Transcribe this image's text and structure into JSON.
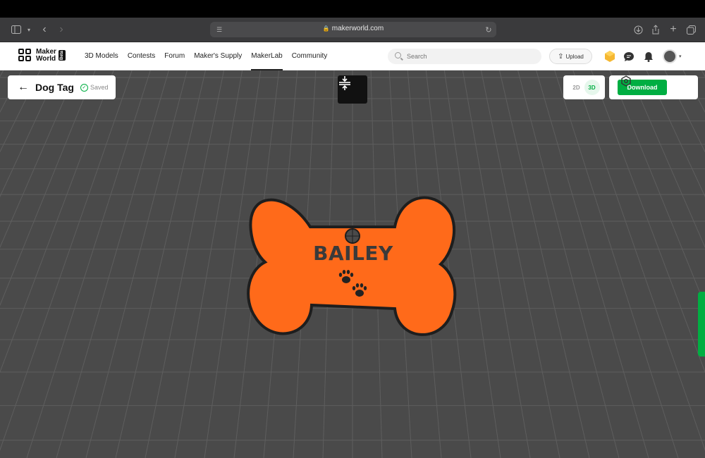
{
  "browser": {
    "url": "makerworld.com"
  },
  "site": {
    "logo_line1": "Maker",
    "logo_line2": "World",
    "logo_badge": "Beta",
    "nav": [
      "3D Models",
      "Contests",
      "Forum",
      "Maker's Supply",
      "MakerLab",
      "Community"
    ],
    "active_nav": "MakerLab",
    "search_placeholder": "Search",
    "upload_label": "Upload"
  },
  "editor": {
    "title": "Dog Tag",
    "saved_label": "Saved",
    "view_2d": "2D",
    "view_3d": "3D",
    "active_view": "3D",
    "download_label": "Download"
  },
  "model": {
    "name_text": "BAILEY",
    "shape": "dog bone tag",
    "color": "#ff6a1a",
    "outline_color": "#1e1e1e"
  },
  "colors": {
    "accent": "#00ae42",
    "canvas_bg": "#4a4a4a"
  }
}
